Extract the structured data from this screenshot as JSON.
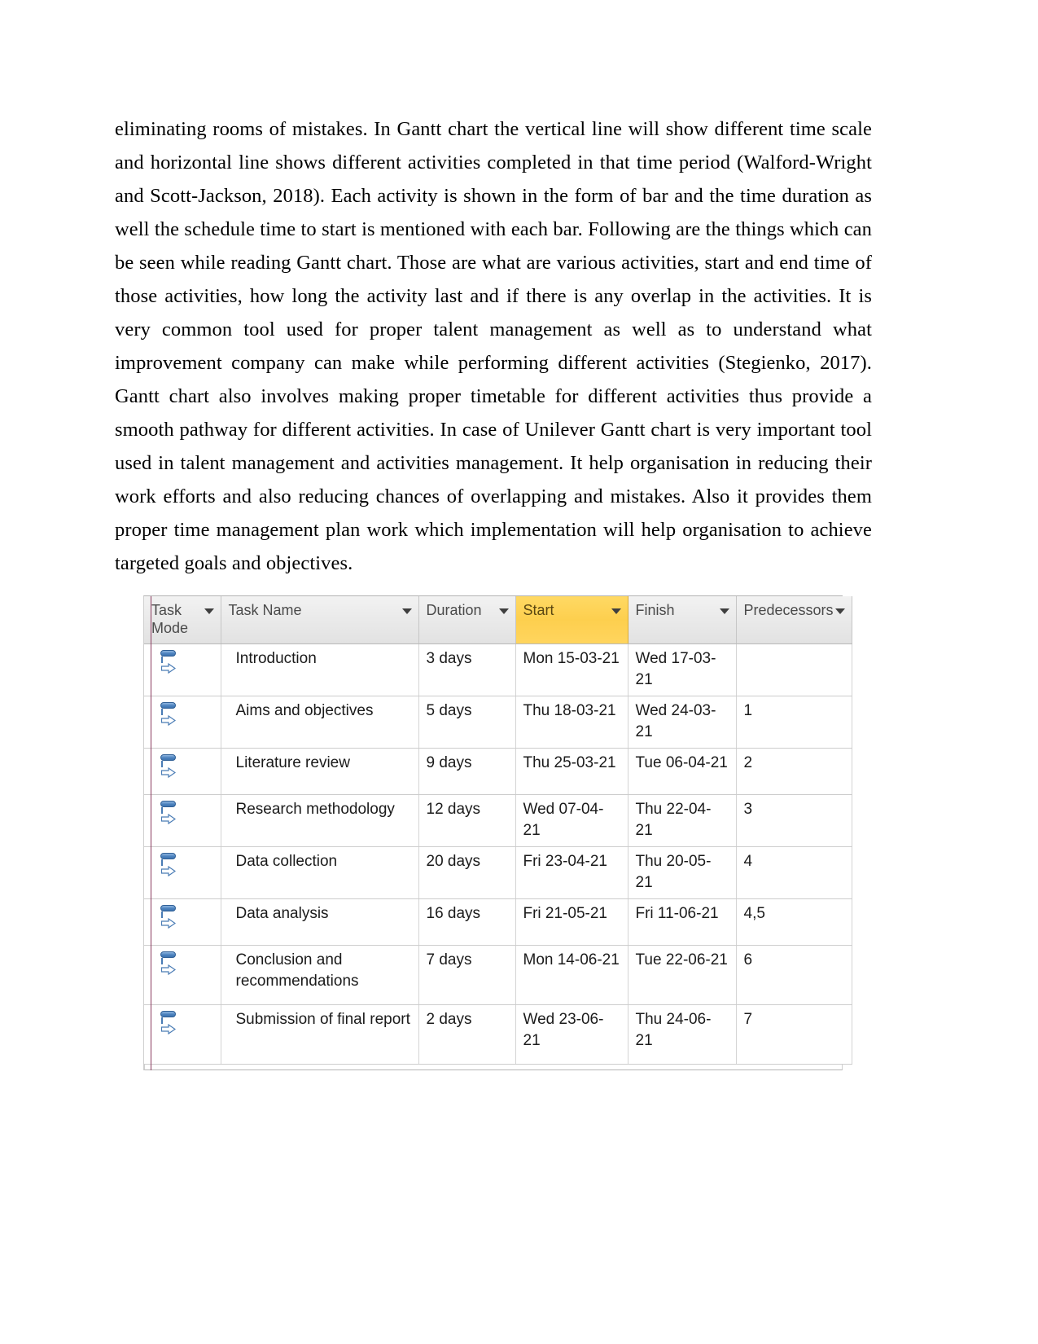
{
  "document": {
    "paragraph": "eliminating rooms of mistakes. In Gantt chart the vertical line will show different time scale and horizontal line shows different activities completed in that time period (Walford-Wright and Scott-Jackson, 2018). Each activity is shown in the form of bar and the time duration as well the schedule time to start is mentioned with each bar. Following are the things which can be seen while reading Gantt chart. Those are what are various activities, start and end time of those activities, how long the activity last and if there is any overlap in the activities. It is very common tool used for proper talent management as well as to understand what improvement company can make while performing different activities (Stegienko, 2017). Gantt chart also involves making proper timetable for different activities thus provide a smooth pathway for different activities. In case of Unilever Gantt chart is very important tool used in talent management and activities management. It help organisation in reducing their work efforts and also reducing chances of overlapping and mistakes. Also it provides them proper time management plan work which implementation will help organisation to achieve targeted goals and objectives."
  },
  "project_table": {
    "columns": [
      {
        "key": "task_mode",
        "label": "Task Mode",
        "has_filter": true,
        "highlighted": false
      },
      {
        "key": "task_name",
        "label": "Task Name",
        "has_filter": true,
        "highlighted": false
      },
      {
        "key": "duration",
        "label": "Duration",
        "has_filter": true,
        "highlighted": false
      },
      {
        "key": "start",
        "label": "Start",
        "has_filter": true,
        "highlighted": true
      },
      {
        "key": "finish",
        "label": "Finish",
        "has_filter": true,
        "highlighted": false
      },
      {
        "key": "predecessors",
        "label": "Predecessors",
        "has_filter": true,
        "highlighted": false
      }
    ],
    "highlight_color": "#ffd45a",
    "task_mode_icon": "auto-scheduled-icon",
    "rows": [
      {
        "task_mode": "auto-scheduled-icon",
        "task_name": "Introduction",
        "duration": "3 days",
        "start": "Mon 15-03-21",
        "finish": "Wed 17-03-21",
        "predecessors": ""
      },
      {
        "task_mode": "auto-scheduled-icon",
        "task_name": "Aims and objectives",
        "duration": "5 days",
        "start": "Thu 18-03-21",
        "finish": "Wed 24-03-21",
        "predecessors": "1"
      },
      {
        "task_mode": "auto-scheduled-icon",
        "task_name": "Literature review",
        "duration": "9 days",
        "start": "Thu 25-03-21",
        "finish": "Tue 06-04-21",
        "predecessors": "2"
      },
      {
        "task_mode": "auto-scheduled-icon",
        "task_name": "Research methodology",
        "duration": "12 days",
        "start": "Wed 07-04-21",
        "finish": "Thu 22-04-21",
        "predecessors": "3"
      },
      {
        "task_mode": "auto-scheduled-icon",
        "task_name": "Data collection",
        "duration": "20 days",
        "start": "Fri 23-04-21",
        "finish": "Thu 20-05-21",
        "predecessors": "4"
      },
      {
        "task_mode": "auto-scheduled-icon",
        "task_name": "Data analysis",
        "duration": "16 days",
        "start": "Fri 21-05-21",
        "finish": "Fri 11-06-21",
        "predecessors": "4,5"
      },
      {
        "task_mode": "auto-scheduled-icon",
        "task_name": "Conclusion and recommendations",
        "duration": "7 days",
        "start": "Mon 14-06-21",
        "finish": "Tue 22-06-21",
        "predecessors": "6"
      },
      {
        "task_mode": "auto-scheduled-icon",
        "task_name": "Submission of final report",
        "duration": "2 days",
        "start": "Wed 23-06-21",
        "finish": "Thu 24-06-21",
        "predecessors": "7"
      }
    ]
  }
}
